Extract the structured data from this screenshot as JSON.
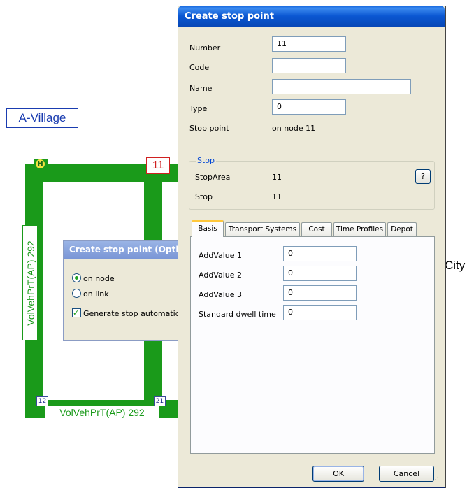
{
  "map": {
    "village_label": "A-Village",
    "city_label": "City",
    "volume_label_vertical": "VolVehPrT(AP)  292",
    "volume_label_horizontal": "VolVehPrT(AP)  292",
    "node_label_selected": "11",
    "node_label_12": "12",
    "node_label_21": "21",
    "stop_marker_letter": "H",
    "link_color": "#1a9a1a",
    "label_color": "#1a3cb0"
  },
  "options_dialog": {
    "title": "Create stop point (Optio",
    "on_node_label": "on node",
    "on_link_label": "on link",
    "generate_label": "Generate stop automatical",
    "on_node_selected": true,
    "generate_checked": true
  },
  "dialog": {
    "title": "Create stop point",
    "fields": {
      "number_label": "Number",
      "number_value": "11",
      "code_label": "Code",
      "code_value": "",
      "name_label": "Name",
      "name_value": "",
      "type_label": "Type",
      "type_value": "0",
      "stop_point_label": "Stop point",
      "stop_point_value": "on node 11"
    },
    "stop_group": {
      "title": "Stop",
      "stoparea_label": "StopArea",
      "stoparea_value": "11",
      "stop_label": "Stop",
      "stop_value": "11",
      "help_button": "?"
    },
    "tabs": [
      "Basis",
      "Transport Systems",
      "Cost",
      "Time Profiles",
      "Depot"
    ],
    "active_tab": "Basis",
    "basis": {
      "addvalue1_label": "AddValue 1",
      "addvalue1_value": "0",
      "addvalue2_label": "AddValue 2",
      "addvalue2_value": "0",
      "addvalue3_label": "AddValue 3",
      "addvalue3_value": "0",
      "dwell_label": "Standard dwell time",
      "dwell_value": "0"
    },
    "ok_button": "OK",
    "cancel_button": "Cancel",
    "title_color": "#0a57d2",
    "group_title_color": "#0046d5"
  }
}
